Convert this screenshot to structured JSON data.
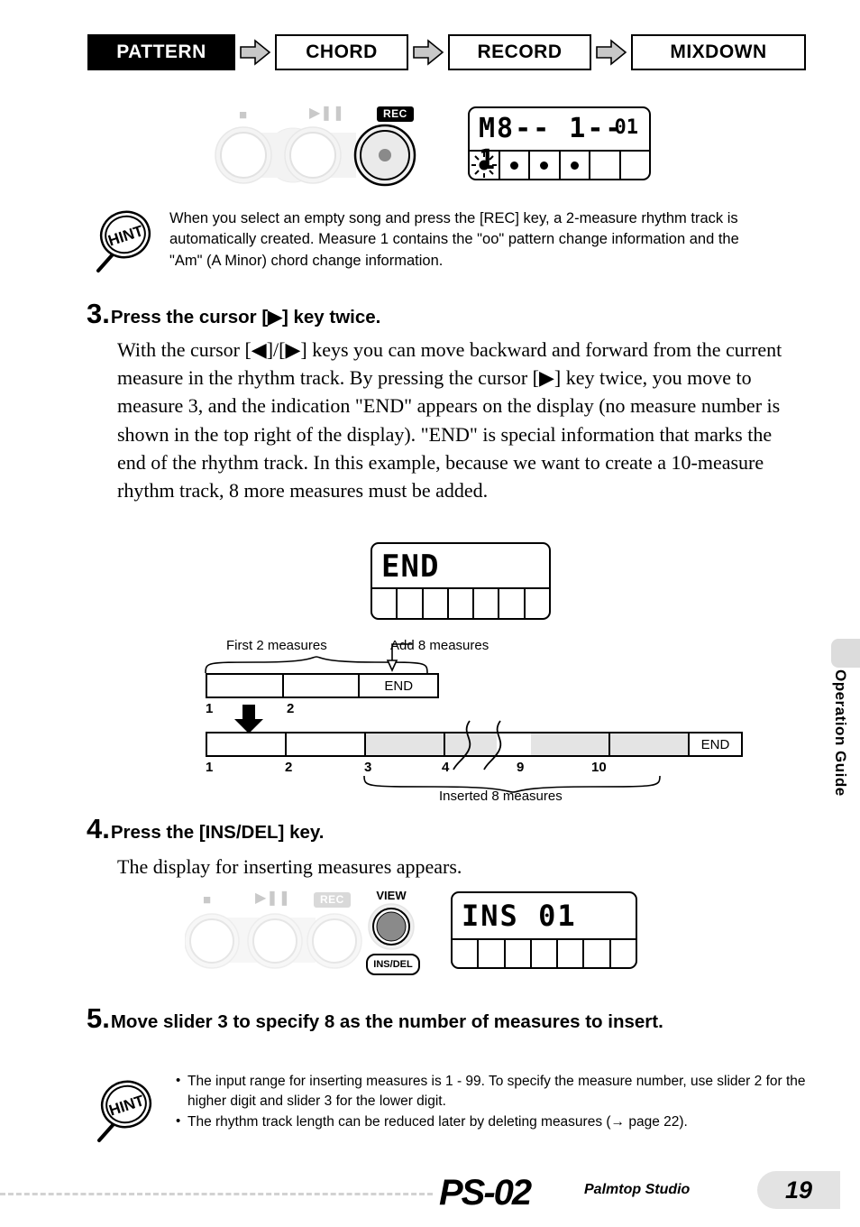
{
  "header": {
    "steps": [
      {
        "label": "PATTERN",
        "active": true
      },
      {
        "label": "CHORD",
        "active": false
      },
      {
        "label": "RECORD",
        "active": false
      },
      {
        "label": "MIXDOWN",
        "active": false
      }
    ],
    "arrow_icon": "right-arrow-icon"
  },
  "panel_top": {
    "stop_icon": "stop-icon",
    "play_pause_icon": "play-pause-icon",
    "rec_label": "REC",
    "rec_button_name": "rec-button"
  },
  "lcd_top": {
    "main_text": "M8-- 1-- 1",
    "sub_text": "01",
    "cells": [
      {
        "dot": true,
        "flash": true
      },
      {
        "dot": true,
        "flash": false
      },
      {
        "dot": true,
        "flash": false
      },
      {
        "dot": true,
        "flash": false
      },
      {
        "dot": false,
        "flash": false
      },
      {
        "dot": false,
        "flash": false
      }
    ]
  },
  "hint_top": {
    "badge": "HINT",
    "text": "When you select an empty song and press the [REC] key, a 2-measure rhythm track is automatically created. Measure 1 contains the \"oo\" pattern change information and the \"Am\" (A Minor) chord change information."
  },
  "step3": {
    "number": "3.",
    "title": "Press the cursor [▶] key twice.",
    "body": "With the cursor [◀]/[▶] keys you can move backward and forward from the current measure in the rhythm track. By pressing the cursor [▶] key twice, you move to measure 3, and the indication \"END\" appears on the display (no measure number is shown in the top right of the display). \"END\" is special information that marks the end of the rhythm track. In this example, because we want to create a 10-measure rhythm track, 8 more measures must be added."
  },
  "lcd_end": {
    "main_text": "END",
    "cells": [
      {
        "dot": false
      },
      {
        "dot": false
      },
      {
        "dot": false
      },
      {
        "dot": false
      },
      {
        "dot": false
      },
      {
        "dot": false
      },
      {
        "dot": false
      }
    ]
  },
  "diagram": {
    "label_first": "First 2 measures",
    "label_add": "Add 8 measures",
    "label_inserted": "Inserted 8 measures",
    "end_label": "END",
    "top_bar": {
      "numbers": [
        "1",
        "2"
      ],
      "segments": [
        "",
        "",
        "END"
      ]
    },
    "bottom_bar": {
      "numbers": [
        "1",
        "2",
        "3",
        "4",
        "9",
        "10"
      ],
      "segments": [
        {
          "label": "",
          "shaded": false
        },
        {
          "label": "",
          "shaded": false
        },
        {
          "label": "",
          "shaded": true
        },
        {
          "label": "",
          "shaded": true
        },
        {
          "label": "",
          "shaded": true
        },
        {
          "label": "",
          "shaded": true
        },
        {
          "label": "",
          "shaded": true
        },
        {
          "label": "END",
          "shaded": false
        }
      ]
    }
  },
  "step4": {
    "number": "4.",
    "title": "Press the [INS/DEL] key.",
    "body": "The display for inserting measures appears."
  },
  "panel_bottom": {
    "stop_icon": "stop-icon",
    "play_pause_icon": "play-pause-icon",
    "rec_label": "REC",
    "view_label": "VIEW",
    "insdel_label": "INS/DEL"
  },
  "lcd_ins": {
    "main_text": "INS 01",
    "cells": [
      {
        "dot": false
      },
      {
        "dot": false
      },
      {
        "dot": false
      },
      {
        "dot": false
      },
      {
        "dot": false
      },
      {
        "dot": false
      },
      {
        "dot": false
      }
    ]
  },
  "step5": {
    "number": "5.",
    "title": "Move slider 3 to specify 8 as the number of measures to insert."
  },
  "hint_bottom": {
    "badge": "HINT",
    "bullets": [
      "The input range for inserting measures is 1 - 99. To specify the measure number, use slider 2 for the higher digit and slider 3 for the lower digit.",
      "The rhythm track length can be reduced later by deleting measures (→ page 22)."
    ]
  },
  "footer": {
    "logo": "PS-02",
    "logo_sub": "Palmtop Studio",
    "page_number": "19",
    "side_tab": "Operation Guide"
  },
  "colors": {
    "accent": "#000000",
    "shade": "#e4e4e4",
    "tab_gray": "#dcdcdc",
    "page_gray": "#e3e3e3"
  }
}
